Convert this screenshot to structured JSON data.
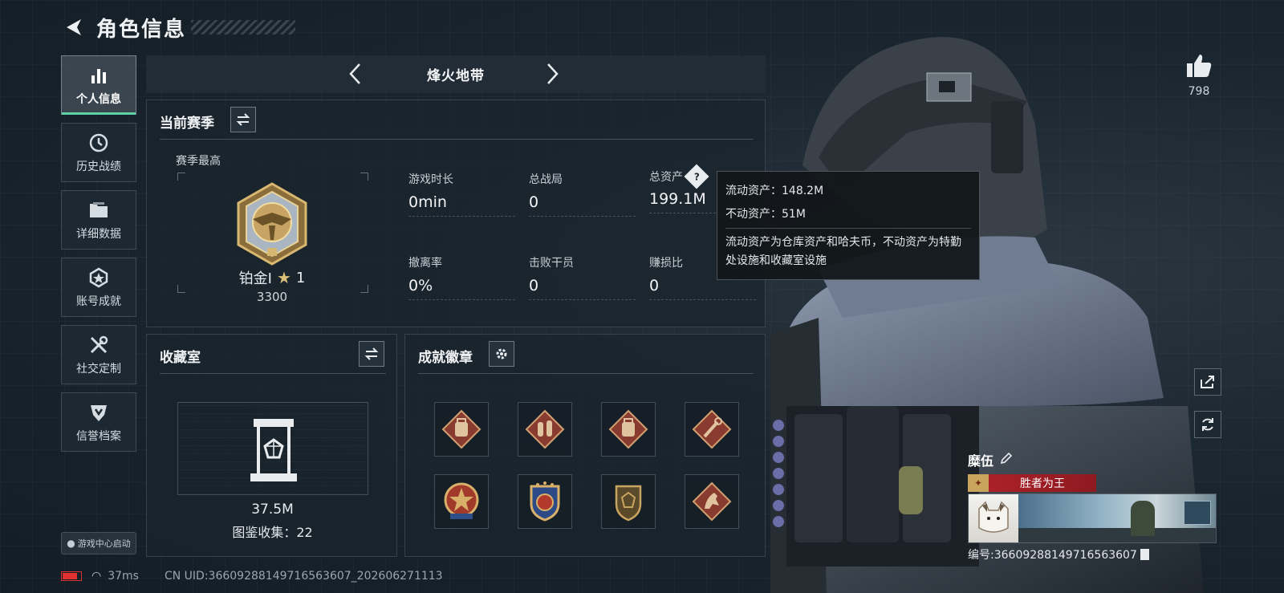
{
  "header": {
    "title": "角色信息"
  },
  "sidebar": {
    "items": [
      {
        "label": "个人信息",
        "icon": "bar-chart-icon",
        "active": true
      },
      {
        "label": "历史战绩",
        "icon": "clock-icon"
      },
      {
        "label": "详细数据",
        "icon": "folder-icon"
      },
      {
        "label": "账号成就",
        "icon": "achievement-icon"
      },
      {
        "label": "社交定制",
        "icon": "tools-icon"
      },
      {
        "label": "信誉档案",
        "icon": "credit-shield-icon"
      }
    ],
    "launch_label": "游戏中心启动"
  },
  "mode": {
    "title": "烽火地带"
  },
  "season": {
    "title": "当前赛季",
    "best_label": "赛季最高",
    "rank_name": "铂金Ⅰ",
    "rank_stars": "1",
    "rank_points": "3300",
    "stats": [
      {
        "label": "游戏时长",
        "value": "0min"
      },
      {
        "label": "总战局",
        "value": "0"
      },
      {
        "label": "总资产",
        "value": "199.1M"
      },
      {
        "label": "撤离率",
        "value": "0%"
      },
      {
        "label": "击败干员",
        "value": "0"
      },
      {
        "label": "赚损比",
        "value": "0"
      }
    ]
  },
  "tooltip": {
    "line1": "流动资产：148.2M",
    "line2": "不动资产：51M",
    "desc": "流动资产为仓库资产和哈夫币，不动资产为特勤处设施和收藏室设施"
  },
  "collection": {
    "title": "收藏室",
    "value": "37.5M",
    "count_text": "图鉴收集：22"
  },
  "achievements": {
    "title": "成就徽章",
    "badges": [
      "backpack-badge",
      "flask-badge",
      "backpack-badge",
      "wrench-badge",
      "star-medal-badge",
      "shield-medal-badge",
      "emblem-badge",
      "horse-badge"
    ]
  },
  "right": {
    "likes": "798",
    "player_name": "糜伍",
    "player_title": "胜者为王",
    "player_id": "编号:3660928814971656360​7"
  },
  "status": {
    "ping": "37ms",
    "uid": "CN UID:3660928814971656360​7_202606271113"
  },
  "colors": {
    "accent": "#5fd1a8",
    "banner": "#b0222a",
    "gold": "#c8a45c"
  }
}
